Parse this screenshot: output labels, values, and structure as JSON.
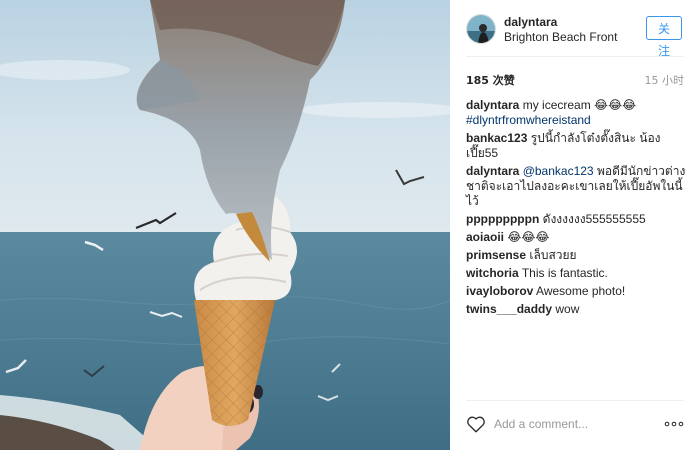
{
  "post": {
    "username": "dalyntara",
    "location": "Brighton Beach Front",
    "follow_label": "关注",
    "likes": "185 次赞",
    "time_ago": "15 小时",
    "caption": {
      "user": "dalyntara",
      "text": "my icecream 😂😂😂",
      "hashtag": "#dlyntrfromwhereistand"
    },
    "comments": [
      {
        "user": "bankac123",
        "text": "รูปนี้กำลังโต๋งตั๊งสินะ น้องเปี๊ย55"
      },
      {
        "user": "dalyntara",
        "mention": "@bankac123",
        "text": "พอดีมีนักข่าวต่างชาติจะเอาไปลงอะคะเขาเลยให้เปี๊ยอัพในนี้ไว้"
      },
      {
        "user": "pppppppppn",
        "text": "ดังงงงงง555555555"
      },
      {
        "user": "aoiaoii",
        "text": "😂😂😂"
      },
      {
        "user": "primsense",
        "text": "เล็บสวยย"
      },
      {
        "user": "witchoria",
        "text": "This is fantastic."
      },
      {
        "user": "ivayloborov",
        "text": "Awesome photo!"
      },
      {
        "user": "twins___daddy",
        "text": "wow"
      }
    ],
    "add_comment_placeholder": "Add a comment...",
    "icons": {
      "like": "heart-outline-icon",
      "more": "more-options-icon"
    }
  },
  "colors": {
    "link": "#003569",
    "accent": "#3897f0",
    "muted": "#999999",
    "sea": "#4f7f95",
    "sky": "#c9dbe6"
  }
}
